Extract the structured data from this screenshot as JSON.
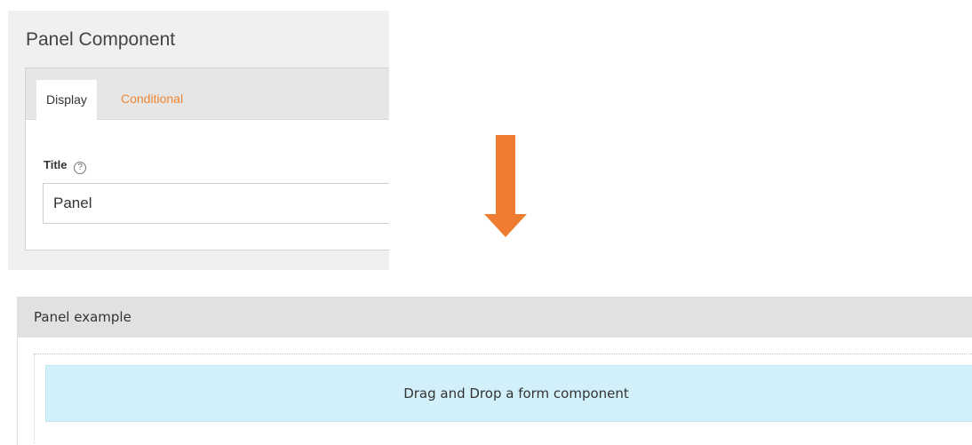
{
  "dialog": {
    "title": "Panel Component",
    "tabs": [
      {
        "label": "Display",
        "active": true
      },
      {
        "label": "Conditional",
        "active": false
      }
    ],
    "field": {
      "label": "Title",
      "help_icon": "?",
      "value": "Panel"
    }
  },
  "arrow": {
    "icon": "down-arrow-icon",
    "color": "#ef7d31"
  },
  "panel": {
    "heading": "Panel example",
    "dropzone_text": "Drag and Drop a form component"
  },
  "colors": {
    "accent": "#f08633",
    "info_bg": "#d1f0fa"
  }
}
